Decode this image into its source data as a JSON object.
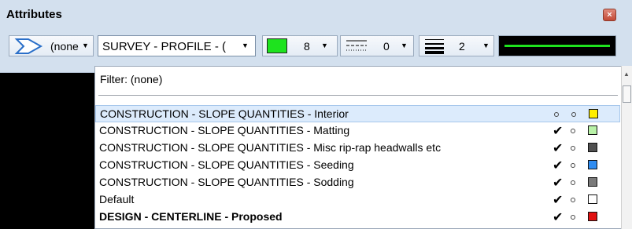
{
  "title": "Attributes",
  "close_glyph": "×",
  "toolbar": {
    "level_value": "(none",
    "style_value": "SURVEY - PROFILE - (",
    "color_value": "8",
    "line_style_value": "0",
    "weight_value": "2",
    "color_swatch": "#1ee31e"
  },
  "dropdown": {
    "filter_text": "Filter: (none)",
    "rows": [
      {
        "label": "CONSTRUCTION - SLOPE QUANTITIES - Interior",
        "check": "",
        "color": "#ffee00",
        "selected": true,
        "bold": false
      },
      {
        "label": "CONSTRUCTION - SLOPE QUANTITIES - Matting",
        "check": "✔",
        "color": "#b9f2a8",
        "selected": false,
        "bold": false
      },
      {
        "label": "CONSTRUCTION - SLOPE QUANTITIES - Misc rip-rap headwalls etc",
        "check": "✔",
        "color": "#505050",
        "selected": false,
        "bold": false
      },
      {
        "label": "CONSTRUCTION - SLOPE QUANTITIES - Seeding",
        "check": "✔",
        "color": "#2f8cf0",
        "selected": false,
        "bold": false
      },
      {
        "label": "CONSTRUCTION - SLOPE QUANTITIES - Sodding",
        "check": "✔",
        "color": "#7a7a7a",
        "selected": false,
        "bold": false
      },
      {
        "label": "Default",
        "check": "✔",
        "color": "#ffffff",
        "selected": false,
        "bold": false
      },
      {
        "label": "DESIGN - CENTERLINE - Proposed",
        "check": "✔",
        "color": "#e01010",
        "selected": false,
        "bold": true
      }
    ]
  }
}
